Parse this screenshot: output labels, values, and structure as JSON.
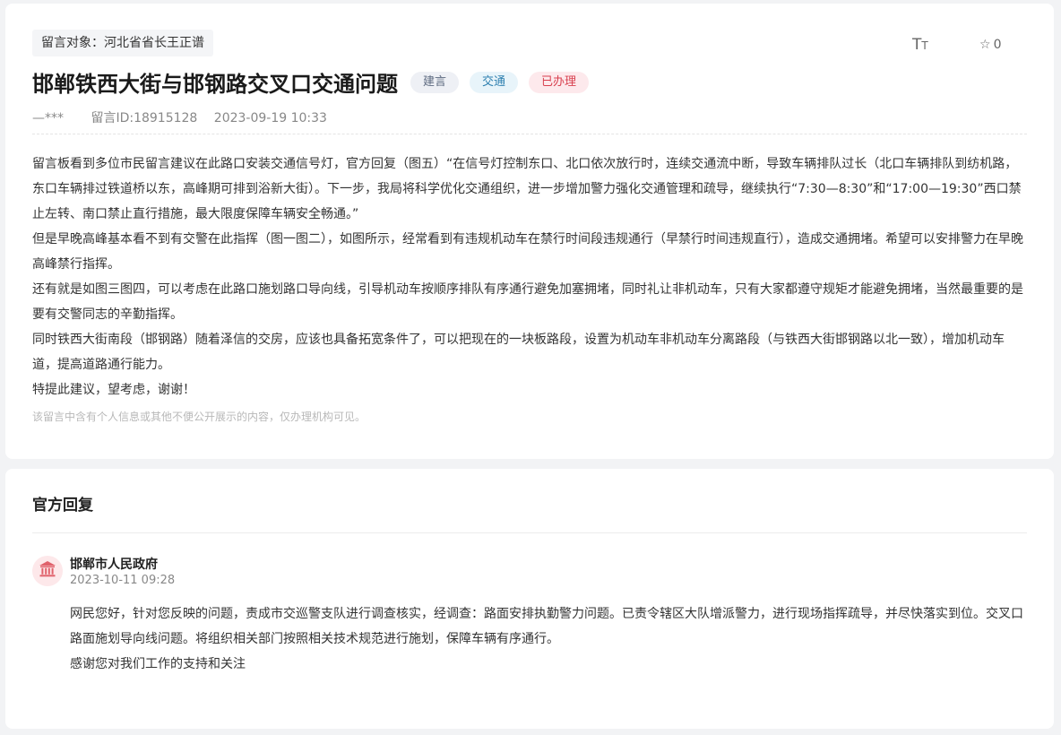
{
  "message": {
    "target": "留言对象：河北省省长王正谱",
    "font_toggle": {
      "large": "T",
      "small": "T"
    },
    "favorite": {
      "icon": "star-outline-icon",
      "count": "0"
    },
    "title": "邯郸铁西大街与邯钢路交叉口交通问题",
    "tags": {
      "type": "建言",
      "category": "交通",
      "status": "已办理"
    },
    "author": "—***",
    "message_id": "留言ID:18915128",
    "time": "2023-09-19 10:33",
    "paragraphs": [
      "留言板看到多位市民留言建议在此路口安装交通信号灯，官方回复（图五）“在信号灯控制东口、北口依次放行时，连续交通流中断，导致车辆排队过长（北口车辆排队到纺机路，东口车辆排过铁道桥以东，高峰期可排到浴新大街）。下一步，我局将科学优化交通组织，进一步增加警力强化交通管理和疏导，继续执行“7:30—8:30”和“17:00—19:30”西口禁止左转、南口禁止直行措施，最大限度保障车辆安全畅通。”",
      "但是早晚高峰基本看不到有交警在此指挥（图一图二），如图所示，经常看到有违规机动车在禁行时间段违规通行（早禁行时间违规直行），造成交通拥堵。希望可以安排警力在早晚高峰禁行指挥。",
      "还有就是如图三图四，可以考虑在此路口施划路口导向线，引导机动车按顺序排队有序通行避免加塞拥堵，同时礼让非机动车，只有大家都遵守规矩才能避免拥堵，当然最重要的是要有交警同志的辛勤指挥。",
      "同时铁西大街南段（邯钢路）随着泽信的交房，应该也具备拓宽条件了，可以把现在的一块板路段，设置为机动车非机动车分离路段（与铁西大街邯钢路以北一致），增加机动车道，提高道路通行能力。",
      "特提此建议，望考虑，谢谢！"
    ],
    "privacy_note": "该留言中含有个人信息或其他不便公开展示的内容，仅办理机构可见。"
  },
  "reply": {
    "heading": "官方回复",
    "org_icon": "government-building-icon",
    "org_name": "邯郸市人民政府",
    "time": "2023-10-11 09:28",
    "paragraphs": [
      "网民您好，针对您反映的问题，责成市交巡警支队进行调查核实，经调查：路面安排执勤警力问题。已责令辖区大队增派警力，进行现场指挥疏导，并尽快落实到位。交叉口路面施划导向线问题。将组织相关部门按照相关技术规范进行施划，保障车辆有序通行。",
      "感谢您对我们工作的支持和关注"
    ]
  },
  "colors": {
    "page_background": "#f2f3f5",
    "status_tag": "#d8404f",
    "category_tag": "#2f80b0",
    "org_icon": "#e0616b"
  }
}
